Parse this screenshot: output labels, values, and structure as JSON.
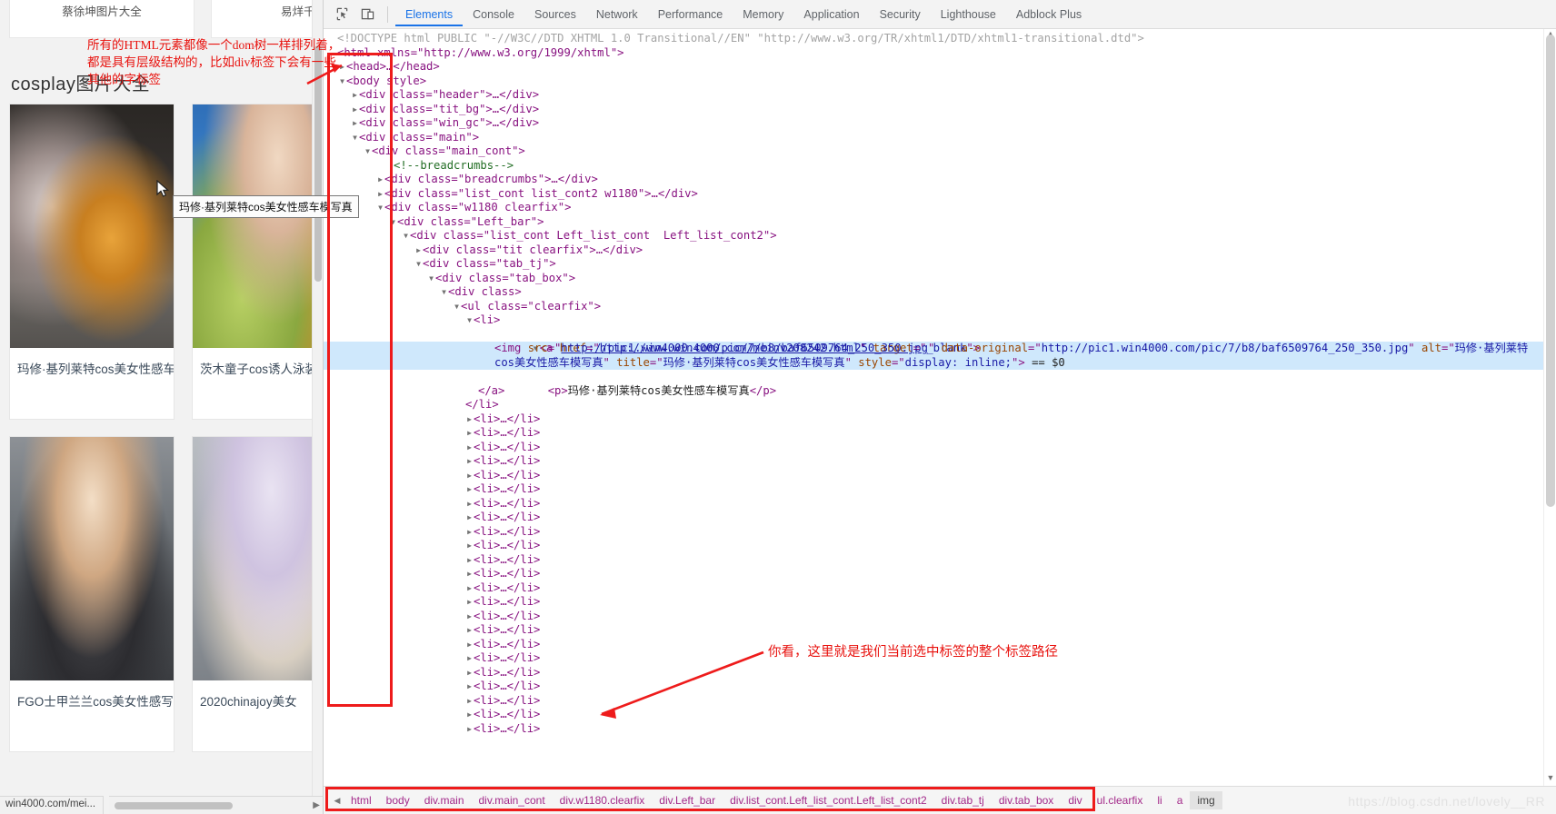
{
  "page": {
    "top_cards": [
      "蔡徐坤图片大全",
      "易烊千玺"
    ],
    "title": "cosplay图片大全",
    "cards": [
      {
        "caption": "玛修·基列莱特cos美女性感车"
      },
      {
        "caption": "茨木童子cos诱人泳装"
      },
      {
        "caption": "FGO士甲兰兰cos美女性感写"
      },
      {
        "caption": "2020chinajoy美女"
      }
    ],
    "tooltip": "玛修·基列莱特cos美女性感车模写真",
    "status_bar": "win4000.com/mei..."
  },
  "devtools": {
    "toolbar_icons": [
      "inspect-element-icon",
      "device-toolbar-icon"
    ],
    "tabs": [
      {
        "label": "Elements",
        "active": true
      },
      {
        "label": "Console",
        "active": false
      },
      {
        "label": "Sources",
        "active": false
      },
      {
        "label": "Network",
        "active": false
      },
      {
        "label": "Performance",
        "active": false
      },
      {
        "label": "Memory",
        "active": false
      },
      {
        "label": "Application",
        "active": false
      },
      {
        "label": "Security",
        "active": false
      },
      {
        "label": "Lighthouse",
        "active": false
      },
      {
        "label": "Adblock Plus",
        "active": false
      }
    ],
    "tree": {
      "doctype": "<!DOCTYPE html PUBLIC \"-//W3C//DTD XHTML 1.0 Transitional//EN\" \"http://www.w3.org/TR/xhtml1/DTD/xhtml1-transitional.dtd\">",
      "html_open_tag": "<html xmlns=\"http://www.w3.org/1999/xhtml\">",
      "head_line": "<head>…</head>",
      "body_line": "<body style>",
      "div_header": "<div class=\"header\">…</div>",
      "div_tit_bg": "<div class=\"tit_bg\">…</div>",
      "div_win_gc": "<div class=\"win_gc\">…</div>",
      "div_main": "<div class=\"main\">",
      "div_main_cont": "<div class=\"main_cont\">",
      "comment_breadcrumbs": "<!--breadcrumbs-->",
      "div_breadcrumbs": "<div class=\"breadcrumbs\">…</div>",
      "div_list_cont2": "<div class=\"list_cont list_cont2 w1180\">…</div>",
      "div_w1180": "<div class=\"w1180 clearfix\">",
      "div_left_bar": "<div class=\"Left_bar\">",
      "div_left_list_cont": "<div class=\"list_cont Left_list_cont  Left_list_cont2\">",
      "div_tit_clearfix": "<div class=\"tit clearfix\">…</div>",
      "div_tab_tj": "<div class=\"tab_tj\">",
      "div_tab_box": "<div class=\"tab_box\">",
      "div_class": "<div class>",
      "ul_clearfix": "<ul class=\"clearfix\">",
      "li_open": "<li>",
      "a_href": "http://www.win4000.com/meinv208242.html",
      "a_target": "_blank",
      "img_src": "http://pic1.win4000.com/pic/7/b8/baf6509764_250_350.jpg",
      "img_data_original": "http://pic1.win4000.com/pic/7/b8/baf6509764_250_350.jpg",
      "img_alt": "玛修·基列莱特cos美女性感车模写真",
      "img_title": "玛修·基列莱特cos美女性感车模写真",
      "img_style": "display: inline;",
      "selected_marker": "== $0",
      "p_text": "玛修·基列莱特cos美女性感车模写真",
      "a_close": "</a>",
      "li_close": "</li>",
      "collapsed_li": "<li>…</li>",
      "collapsed_li_count": 23
    },
    "breadcrumbs": [
      "html",
      "body",
      "div.main",
      "div.main_cont",
      "div.w1180.clearfix",
      "div.Left_bar",
      "div.list_cont.Left_list_cont.Left_list_cont2",
      "div.tab_tj",
      "div.tab_box",
      "div",
      "ul.clearfix",
      "li",
      "a",
      "img"
    ],
    "breadcrumb_active": "img",
    "watermark": "https://blog.csdn.net/lovely__RR"
  },
  "annotations": {
    "top": "所有的HTML元素都像一个dom树一样排列着，都是具有层级结构的，比如div标签下会有一些其他的字标签",
    "bottom": "你看，这里就是我们当前选中标签的整个标签路径",
    "color": "#ee1b1b"
  }
}
